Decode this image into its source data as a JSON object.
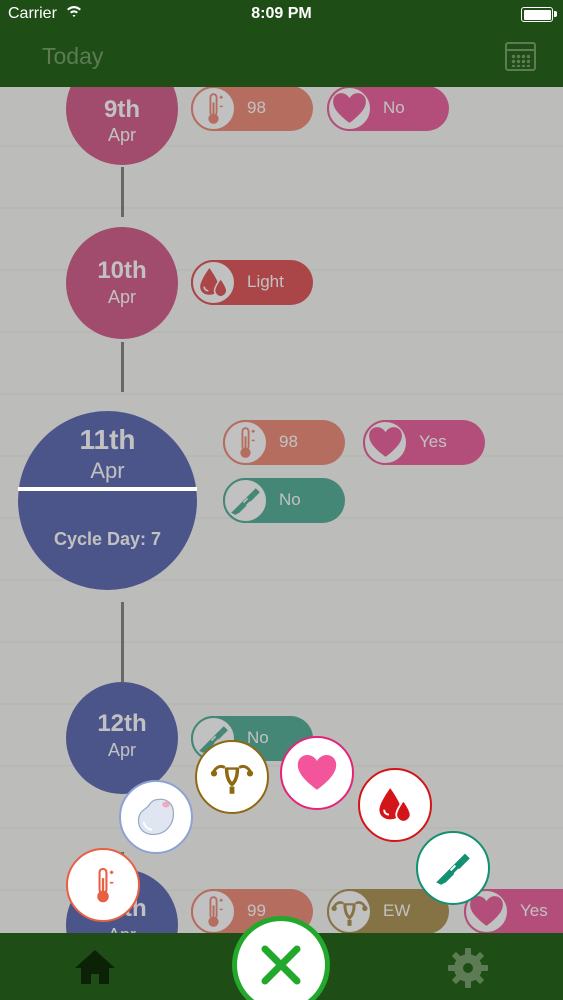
{
  "status_bar": {
    "carrier": "Carrier",
    "wifi_icon": "wifi-icon",
    "time": "8:09 PM",
    "battery_icon": "battery-icon"
  },
  "nav": {
    "title": "Today",
    "calendar_icon": "calendar-icon"
  },
  "days": [
    {
      "day": "9th",
      "month": "Apr",
      "color": "#c21f5c",
      "entries": [
        {
          "icon": "thermometer-icon",
          "value": "98"
        },
        {
          "icon": "heart-icon",
          "value": "No"
        }
      ]
    },
    {
      "day": "10th",
      "month": "Apr",
      "color": "#c21f5c",
      "entries": [
        {
          "icon": "blood-drop-icon",
          "value": "Light"
        }
      ]
    },
    {
      "day": "11th",
      "month": "Apr",
      "color": "#1f3196",
      "cycle_day": "Cycle Day: 7",
      "entries": [
        {
          "icon": "thermometer-icon",
          "value": "98"
        },
        {
          "icon": "heart-icon",
          "value": "Yes"
        },
        {
          "icon": "ovulation-test-icon",
          "value": "No"
        }
      ]
    },
    {
      "day": "12th",
      "month": "Apr",
      "color": "#1f3196",
      "entries": [
        {
          "icon": "ovulation-test-icon",
          "value": "No"
        }
      ]
    },
    {
      "day": "13th",
      "month": "Apr",
      "color": "#1f3196",
      "entries": [
        {
          "icon": "thermometer-icon",
          "value": "99"
        },
        {
          "icon": "uterus-icon",
          "value": "EW"
        },
        {
          "icon": "heart-icon",
          "value": "Yes"
        }
      ]
    }
  ],
  "quick_add": [
    {
      "name": "temperature",
      "icon": "thermometer-icon"
    },
    {
      "name": "cervical-fluid",
      "icon": "drop-blob-icon"
    },
    {
      "name": "cervix",
      "icon": "uterus-icon"
    },
    {
      "name": "intercourse",
      "icon": "heart-icon"
    },
    {
      "name": "flow",
      "icon": "blood-drop-icon"
    },
    {
      "name": "ovulation-test",
      "icon": "ovulation-test-icon"
    }
  ],
  "colors": {
    "header": "#1e4d16",
    "pink": "#c21f5c",
    "navy": "#1f3196",
    "temp": "#e85f43",
    "love": "#e4247a",
    "flow": "#d31418",
    "test": "#129070",
    "cervix": "#8d6a12",
    "close_ring": "#22a82b"
  },
  "tab_bar": {
    "home_icon": "home-icon",
    "close_icon": "close-icon",
    "settings_icon": "gear-icon"
  }
}
